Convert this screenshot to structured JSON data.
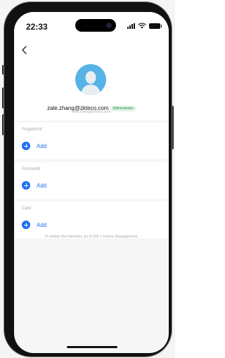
{
  "status_bar": {
    "time": "22:33"
  },
  "user": {
    "email": "zale.zhang@zkteco.com",
    "role_badge": "Administrator",
    "sub_email": "zale.zhang@zkteco.com"
  },
  "sections": [
    {
      "title": "Fingerprint",
      "add_label": "Add"
    },
    {
      "title": "Password",
      "add_label": "Add"
    },
    {
      "title": "Card",
      "add_label": "Add"
    }
  ],
  "footer_note": "To delete the member, go to Me > Home Management.",
  "colors": {
    "accent": "#1f6ff0",
    "avatar": "#57b2e6",
    "badge_text": "#2d8f4a",
    "badge_bg": "#def5e3"
  },
  "icons": [
    "back-chevron-icon",
    "avatar-icon",
    "plus-circle-icon",
    "signal-icon",
    "wifi-icon",
    "battery-icon"
  ]
}
